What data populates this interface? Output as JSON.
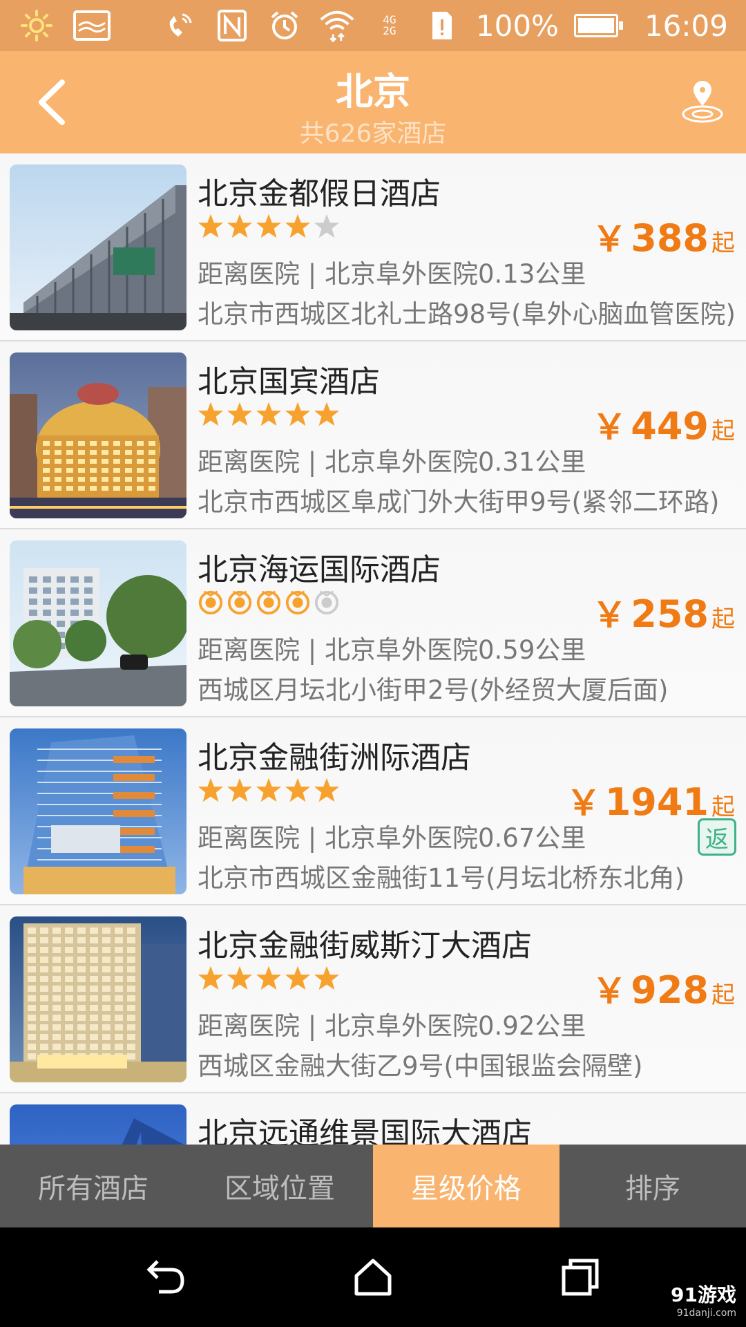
{
  "status_bar": {
    "battery_pct": "100%",
    "battery_level": 1.0,
    "time": "16:09",
    "network_top": "4G",
    "network_bottom": "2G",
    "icons": [
      "sun-icon",
      "image-icon",
      "phone-signal-icon",
      "nfc-icon",
      "alarm-icon",
      "wifi-icon",
      "cell-signal-icon",
      "sim-alert-icon",
      "battery-icon"
    ]
  },
  "header": {
    "title": "北京",
    "subtitle": "共626家酒店",
    "back_icon": "back-arrow-icon",
    "location_icon": "map-pin-icon"
  },
  "hotels": [
    {
      "name": "北京金都假日酒店",
      "rating": 4,
      "rating_style": "star",
      "distance": "距离医院 | 北京阜外医院0.13公里",
      "address": "北京市西城区北礼士路98号(阜外心脑血管医院)",
      "currency": "￥",
      "price": "388",
      "price_suffix": "起",
      "rebate": "",
      "image": "glass-office-building"
    },
    {
      "name": "北京国宾酒店",
      "rating": 5,
      "rating_style": "star",
      "distance": "距离医院 | 北京阜外医院0.31公里",
      "address": "北京市西城区阜成门外大街甲9号(紧邻二环路)",
      "currency": "￥",
      "price": "449",
      "price_suffix": "起",
      "rebate": "",
      "image": "lit-hotel-night"
    },
    {
      "name": "北京海运国际酒店",
      "rating": 4,
      "rating_style": "diamond",
      "distance": "距离医院 | 北京阜外医院0.59公里",
      "address": "西城区月坛北小街甲2号(外经贸大厦后面)",
      "currency": "￥",
      "price": "258",
      "price_suffix": "起",
      "rebate": "",
      "image": "street-hotel-day"
    },
    {
      "name": "北京金融街洲际酒店",
      "rating": 5,
      "rating_style": "star",
      "distance": "距离医院 | 北京阜外医院0.67公里",
      "address": "北京市西城区金融街11号(月坛北桥东北角)",
      "currency": "￥",
      "price": "1941",
      "price_suffix": "起",
      "rebate": "返",
      "image": "blue-tower-hotel"
    },
    {
      "name": "北京金融街威斯汀大酒店",
      "rating": 5,
      "rating_style": "star",
      "distance": "距离医院 | 北京阜外医院0.92公里",
      "address": "西城区金融大街乙9号(中国银监会隔壁)",
      "currency": "￥",
      "price": "928",
      "price_suffix": "起",
      "rebate": "",
      "image": "grid-tower-hotel"
    },
    {
      "name": "北京远通维景国际大酒店",
      "rating": 0,
      "rating_style": "star",
      "distance": "",
      "address": "",
      "currency": "",
      "price": "",
      "price_suffix": "",
      "rebate": "",
      "image": "blue-tower-partial"
    }
  ],
  "tabs": [
    {
      "label": "所有酒店",
      "active": false
    },
    {
      "label": "区域位置",
      "active": false
    },
    {
      "label": "星级价格",
      "active": true
    },
    {
      "label": "排序",
      "active": false
    }
  ],
  "nav": {
    "back_icon": "nav-back-icon",
    "home_icon": "nav-home-icon",
    "recents_icon": "nav-recents-icon"
  },
  "watermark": {
    "main": "91游戏",
    "sub": "91danji.com"
  },
  "colors": {
    "accent": "#f9b46f",
    "status_bar": "#e8a060",
    "price": "#f07b14",
    "star_on": "#f7a22e",
    "star_off": "#cccccc",
    "rebate": "#3cb18a",
    "tab_bar": "#575757"
  }
}
